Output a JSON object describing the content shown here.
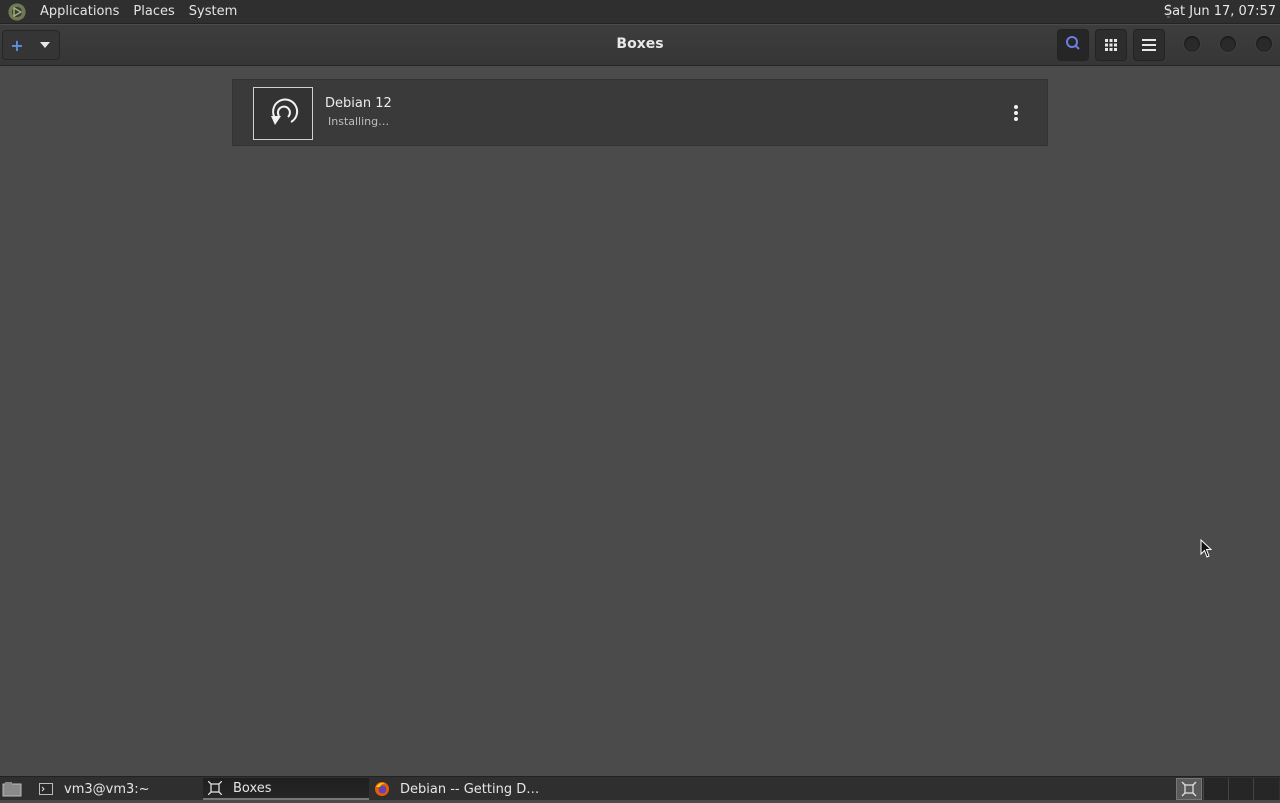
{
  "top_panel": {
    "menus": [
      "Applications",
      "Places",
      "System"
    ],
    "clock": "Sat Jun 17, 07:57"
  },
  "header": {
    "title": "Boxes",
    "new_button_icon": "plus-icon",
    "buttons": [
      "search-icon",
      "grid-view-icon",
      "hamburger-menu-icon"
    ]
  },
  "vm_list": [
    {
      "name": "Debian 12",
      "status": "Installing…"
    }
  ],
  "taskbar": {
    "tasks": [
      {
        "label": "vm3@vm3:~",
        "icon": "terminal-icon"
      },
      {
        "label": "Boxes",
        "icon": "boxes-icon"
      },
      {
        "label": "Debian -- Getting D…",
        "icon": "firefox-icon"
      }
    ]
  },
  "colors": {
    "accent": "#5f8fe0",
    "background": "#4b4b4b",
    "panel": "#2f2f2f"
  }
}
